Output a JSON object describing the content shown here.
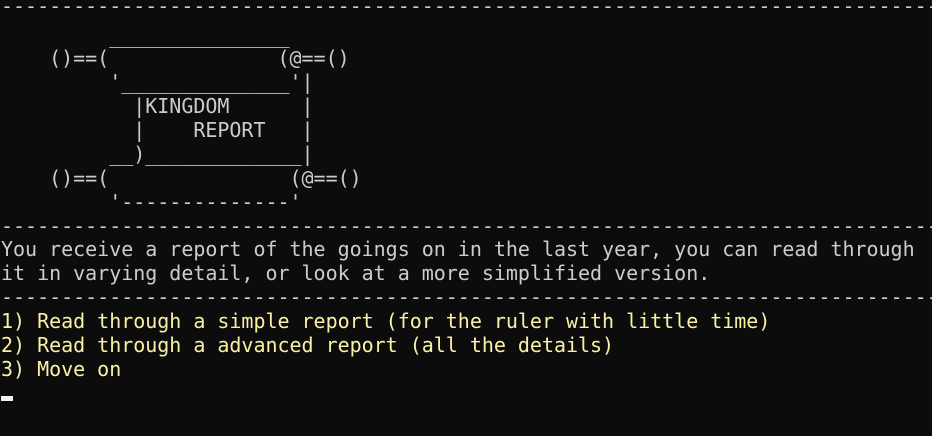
{
  "terminal": {
    "separators": [
      "------------------------------------------------------------------------------",
      "------------------------------------------------------------------------------",
      "------------------------------------------------------------------------------"
    ],
    "banner_art": [
      "         _______________",
      "    ()==(              (@==()",
      "         '______________'|",
      "           |KINGDOM      |",
      "           |    REPORT   |",
      "         __)_____________|",
      "    ()==(               (@==()",
      "         '--------------'"
    ],
    "description_lines": [
      "You receive a report of the goings on in the last year, you can read through",
      "it in varying detail, or look at a more simplified version."
    ],
    "menu_options": [
      "1) Read through a simple report (for the ruler with little time)",
      "2) Read through a advanced report (all the details)",
      "3) Move on"
    ],
    "colors": {
      "background": "#0c0c0c",
      "text": "#cccccc",
      "menu_text": "#f9f1a5",
      "cursor": "#f2f2f2"
    }
  }
}
